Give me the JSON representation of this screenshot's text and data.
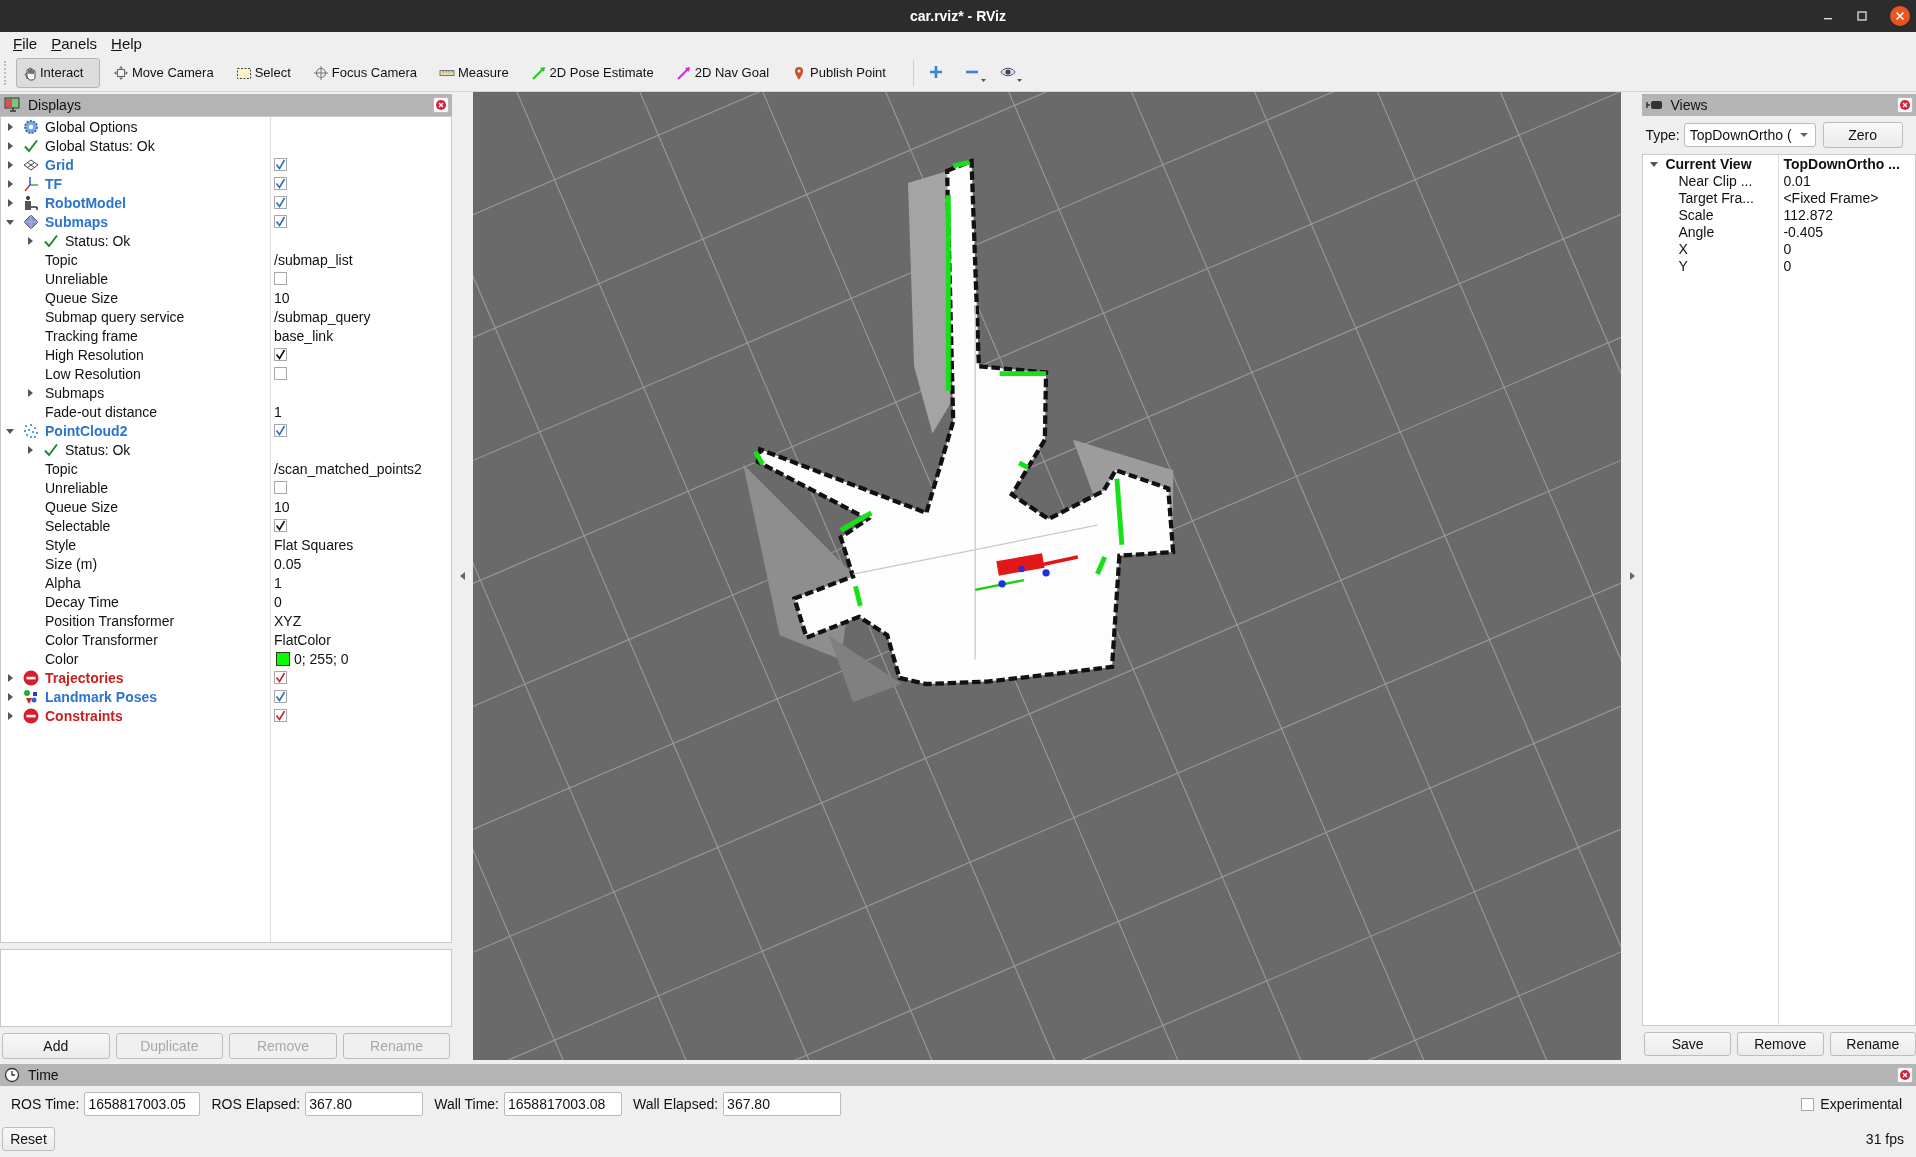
{
  "window": {
    "title": "car.rviz* - RViz"
  },
  "menu": [
    "File",
    "Panels",
    "Help"
  ],
  "toolbar": [
    {
      "label": "Interact",
      "selected": true
    },
    {
      "label": "Move Camera",
      "selected": false
    },
    {
      "label": "Select",
      "selected": false
    },
    {
      "label": "Focus Camera",
      "selected": false
    },
    {
      "label": "Measure",
      "selected": false
    },
    {
      "label": "2D Pose Estimate",
      "selected": false
    },
    {
      "label": "2D Nav Goal",
      "selected": false
    },
    {
      "label": "Publish Point",
      "selected": false
    }
  ],
  "displays": {
    "title": "Displays",
    "items": [
      {
        "label": "Global Options",
        "kind": "group",
        "expanded": false
      },
      {
        "label": "Global Status: Ok",
        "kind": "status",
        "expanded": false
      },
      {
        "label": "Grid",
        "kind": "display",
        "error": false,
        "checked": true,
        "expanded": false
      },
      {
        "label": "TF",
        "kind": "display",
        "error": false,
        "checked": true,
        "expanded": false
      },
      {
        "label": "RobotModel",
        "kind": "display",
        "error": false,
        "checked": true,
        "expanded": false
      },
      {
        "label": "Submaps",
        "kind": "display",
        "error": false,
        "checked": true,
        "expanded": true,
        "children": [
          {
            "label": "Status: Ok",
            "kind": "status",
            "expanded": false
          },
          {
            "label": "Topic",
            "kind": "property",
            "value": "/submap_list"
          },
          {
            "label": "Unreliable",
            "kind": "property",
            "checked": false
          },
          {
            "label": "Queue Size",
            "kind": "property",
            "value": "10"
          },
          {
            "label": "Submap query service",
            "kind": "property",
            "value": "/submap_query"
          },
          {
            "label": "Tracking frame",
            "kind": "property",
            "value": "base_link"
          },
          {
            "label": "High Resolution",
            "kind": "property",
            "checked": true
          },
          {
            "label": "Low Resolution",
            "kind": "property",
            "checked": false
          },
          {
            "label": "Submaps",
            "kind": "group",
            "expanded": false
          },
          {
            "label": "Fade-out distance",
            "kind": "property",
            "value": "1"
          }
        ]
      },
      {
        "label": "PointCloud2",
        "kind": "display",
        "error": false,
        "checked": true,
        "expanded": true,
        "children": [
          {
            "label": "Status: Ok",
            "kind": "status",
            "expanded": false
          },
          {
            "label": "Topic",
            "kind": "property",
            "value": "/scan_matched_points2"
          },
          {
            "label": "Unreliable",
            "kind": "property",
            "checked": false
          },
          {
            "label": "Queue Size",
            "kind": "property",
            "value": "10"
          },
          {
            "label": "Selectable",
            "kind": "property",
            "checked": true
          },
          {
            "label": "Style",
            "kind": "property",
            "value": "Flat Squares"
          },
          {
            "label": "Size (m)",
            "kind": "property",
            "value": "0.05"
          },
          {
            "label": "Alpha",
            "kind": "property",
            "value": "1"
          },
          {
            "label": "Decay Time",
            "kind": "property",
            "value": "0"
          },
          {
            "label": "Position Transformer",
            "kind": "property",
            "value": "XYZ"
          },
          {
            "label": "Color Transformer",
            "kind": "property",
            "value": "FlatColor"
          },
          {
            "label": "Color",
            "kind": "property",
            "value": "0; 255; 0",
            "color": "#00ff00"
          }
        ]
      },
      {
        "label": "Trajectories",
        "kind": "display",
        "error": true,
        "checked": true,
        "expanded": false
      },
      {
        "label": "Landmark Poses",
        "kind": "display",
        "error": false,
        "checked": true,
        "expanded": false
      },
      {
        "label": "Constraints",
        "kind": "display",
        "error": true,
        "checked": true,
        "expanded": false
      }
    ],
    "buttons": [
      {
        "label": "Add",
        "disabled": false
      },
      {
        "label": "Duplicate",
        "disabled": true
      },
      {
        "label": "Remove",
        "disabled": true
      },
      {
        "label": "Rename",
        "disabled": true
      }
    ]
  },
  "views": {
    "title": "Views",
    "type_label": "Type:",
    "type_value": "TopDownOrtho (",
    "zero_button": "Zero",
    "items": [
      {
        "label": "Current View",
        "value": "TopDownOrtho ...",
        "expanded": true,
        "children": [
          {
            "label": "Near Clip ...",
            "value": "0.01"
          },
          {
            "label": "Target Fra...",
            "value": "<Fixed Frame>"
          },
          {
            "label": "Scale",
            "value": "112.872"
          },
          {
            "label": "Angle",
            "value": "-0.405"
          },
          {
            "label": "X",
            "value": "0"
          },
          {
            "label": "Y",
            "value": "0"
          }
        ]
      }
    ],
    "buttons": [
      "Save",
      "Remove",
      "Rename"
    ]
  },
  "time": {
    "title": "Time",
    "fields": [
      {
        "label": "ROS Time:",
        "value": "1658817003.05"
      },
      {
        "label": "ROS Elapsed:",
        "value": "367.80"
      },
      {
        "label": "Wall Time:",
        "value": "1658817003.08"
      },
      {
        "label": "Wall Elapsed:",
        "value": "367.80"
      }
    ],
    "experimental": {
      "label": "Experimental",
      "checked": false
    },
    "reset_button": "Reset",
    "fps": "31 fps"
  }
}
